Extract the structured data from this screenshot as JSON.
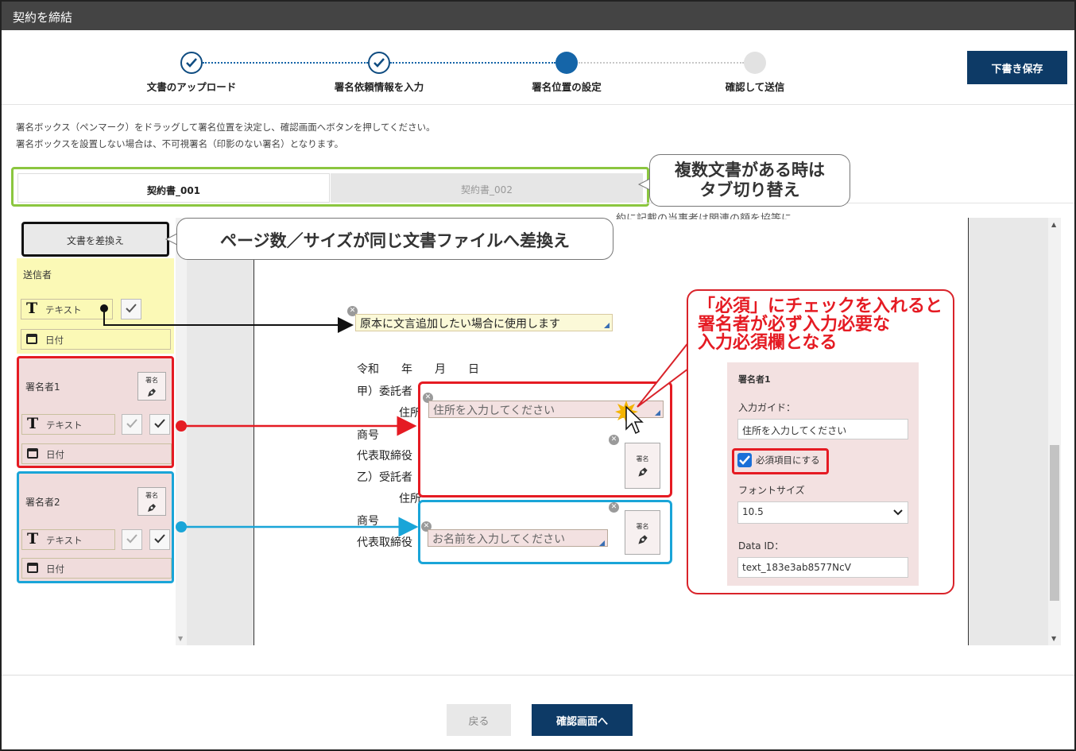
{
  "window": {
    "title": "契約を締結"
  },
  "stepper": {
    "steps": [
      {
        "label": "文書のアップロード",
        "state": "done"
      },
      {
        "label": "署名依頼情報を入力",
        "state": "done"
      },
      {
        "label": "署名位置の設定",
        "state": "current"
      },
      {
        "label": "確認して送信",
        "state": "todo"
      }
    ]
  },
  "header": {
    "draft_save_label": "下書き保存"
  },
  "instructions": [
    "署名ボックス（ペンマーク）をドラッグして署名位置を決定し、確認画面へボタンを押してください。",
    "署名ボックスを設置しない場合は、不可視署名（印影のない署名）となります。"
  ],
  "tabs": [
    {
      "label": "契約書_001",
      "active": true
    },
    {
      "label": "契約書_002",
      "active": false
    }
  ],
  "callouts": {
    "tabs": "複数文書がある時は\nタブ切り替え",
    "replace": "ページ数／サイズが同じ文書ファイルへ差換え",
    "required": "「必須」にチェックを入れると\n署名者が必ず入力必要な\n入力必須欄となる"
  },
  "left_panel": {
    "replace_button": "文書を差換え",
    "sender": {
      "title": "送信者",
      "text_label": "テキスト",
      "date_label": "日付"
    },
    "signer1": {
      "title": "署名者1",
      "text_label": "テキスト",
      "date_label": "日付",
      "sign_label": "署名"
    },
    "signer2": {
      "title": "署名者2",
      "text_label": "テキスト",
      "date_label": "日付",
      "sign_label": "署名"
    }
  },
  "document": {
    "top_partial": "…約に記載の当事者は関連の額を協等に…",
    "sender_field": "原本に文言追加したい場合に使用します",
    "date_line": "令和　　年　　月　　日",
    "party_a": "甲）委託者",
    "address_label": "住所",
    "company_label": "商号",
    "rep_label": "代表取締役",
    "party_b": "乙）受託者",
    "address_label2": "住所",
    "company_label2": "商号",
    "rep_label2": "代表取締役",
    "address_placeholder": "住所を入力してください",
    "name_placeholder": "お名前を入力してください",
    "sign_label": "署名"
  },
  "settings_panel": {
    "title": "署名者1",
    "input_guide_label": "入力ガイド：",
    "input_guide_value": "住所を入力してください",
    "required_label": "必須項目にする",
    "required_checked": true,
    "font_size_label": "フォントサイズ",
    "font_size_value": "10.5",
    "data_id_label": "Data ID：",
    "data_id_value": "text_183e3ab8577NcV"
  },
  "footer": {
    "back_label": "戻る",
    "next_label": "確認画面へ"
  },
  "colors": {
    "navy": "#0d3a66",
    "signer1": "#e51b23",
    "signer2": "#1aa5d8",
    "tab_highlight": "#8bc63f"
  }
}
